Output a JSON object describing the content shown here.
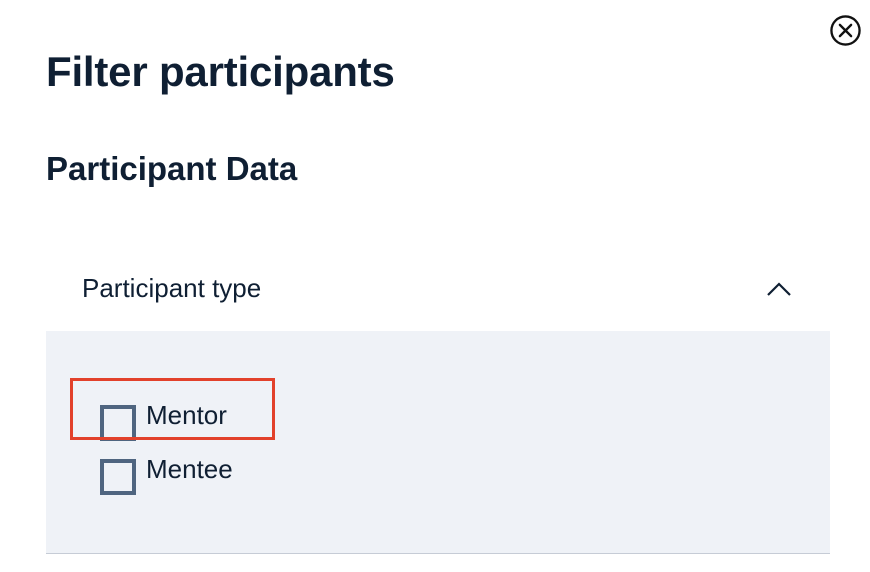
{
  "dialog": {
    "title": "Filter participants",
    "close_icon": "close-circle-icon",
    "section_title": "Participant Data"
  },
  "accordion": {
    "title": "Participant type",
    "expanded": true,
    "chevron_icon": "chevron-up-icon",
    "options": [
      {
        "label": "Mentor",
        "checked": false
      },
      {
        "label": "Mentee",
        "checked": false
      }
    ]
  },
  "colors": {
    "text": "#0f1f33",
    "panel_bg": "#eff2f7",
    "checkbox_border": "#4f6580",
    "highlight": "#e2412b"
  }
}
